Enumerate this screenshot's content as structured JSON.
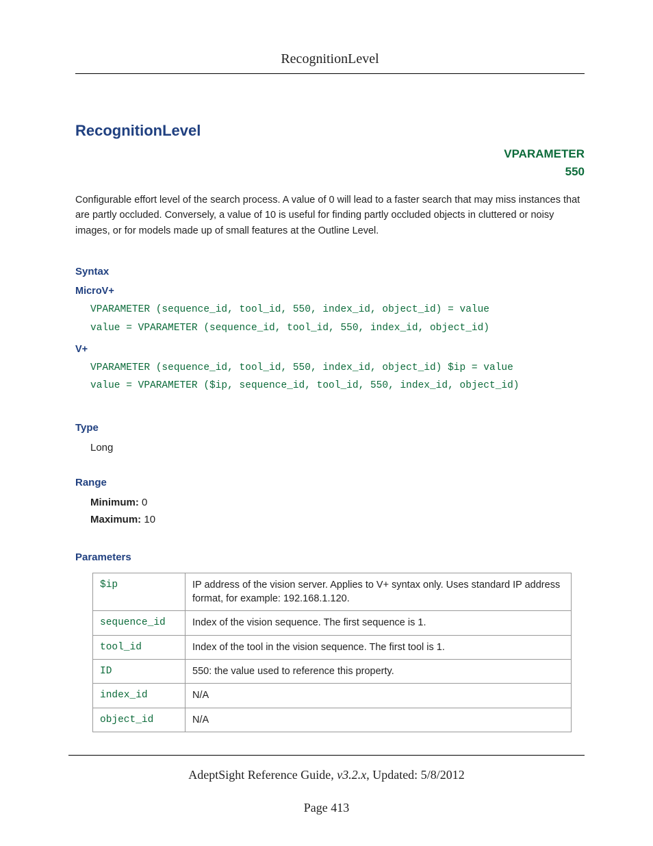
{
  "header": {
    "title": "RecognitionLevel"
  },
  "title": "RecognitionLevel",
  "tag": {
    "name": "VPARAMETER",
    "id": "550"
  },
  "description": "Configurable effort level of the search process. A value of 0 will lead to a faster search that may miss instances that are partly occluded. Conversely, a value of 10 is useful for finding partly occluded objects in cluttered or noisy images, or for models made up of small features at the Outline Level.",
  "syntax": {
    "heading": "Syntax",
    "microv": {
      "label": "MicroV+",
      "code": "VPARAMETER (sequence_id, tool_id, 550, index_id, object_id) = value\nvalue = VPARAMETER (sequence_id, tool_id, 550, index_id, object_id)"
    },
    "vplus": {
      "label": "V+",
      "code": "VPARAMETER (sequence_id, tool_id, 550, index_id, object_id) $ip = value\nvalue = VPARAMETER ($ip, sequence_id, tool_id, 550, index_id, object_id)"
    }
  },
  "type": {
    "heading": "Type",
    "value": "Long"
  },
  "range": {
    "heading": "Range",
    "min_label": "Minimum:",
    "min_value": "0",
    "max_label": "Maximum:",
    "max_value": "10"
  },
  "parameters": {
    "heading": "Parameters",
    "rows": [
      {
        "key": "$ip",
        "desc": "IP address of the vision server. Applies to V+ syntax only. Uses standard IP address format, for example: 192.168.1.120."
      },
      {
        "key": "sequence_id",
        "desc": "Index of the vision sequence. The first sequence is 1."
      },
      {
        "key": "tool_id",
        "desc": "Index of the tool in the vision sequence. The first tool is 1."
      },
      {
        "key": "ID",
        "desc": "550: the value used to reference this property."
      },
      {
        "key": "index_id",
        "desc": "N/A"
      },
      {
        "key": "object_id",
        "desc": "N/A"
      }
    ]
  },
  "footer": {
    "guide": "AdeptSight Reference Guide",
    "version": "v3.2.x",
    "updated_label": "Updated:",
    "updated": "5/8/2012",
    "page_label": "Page",
    "page_num": "413"
  }
}
